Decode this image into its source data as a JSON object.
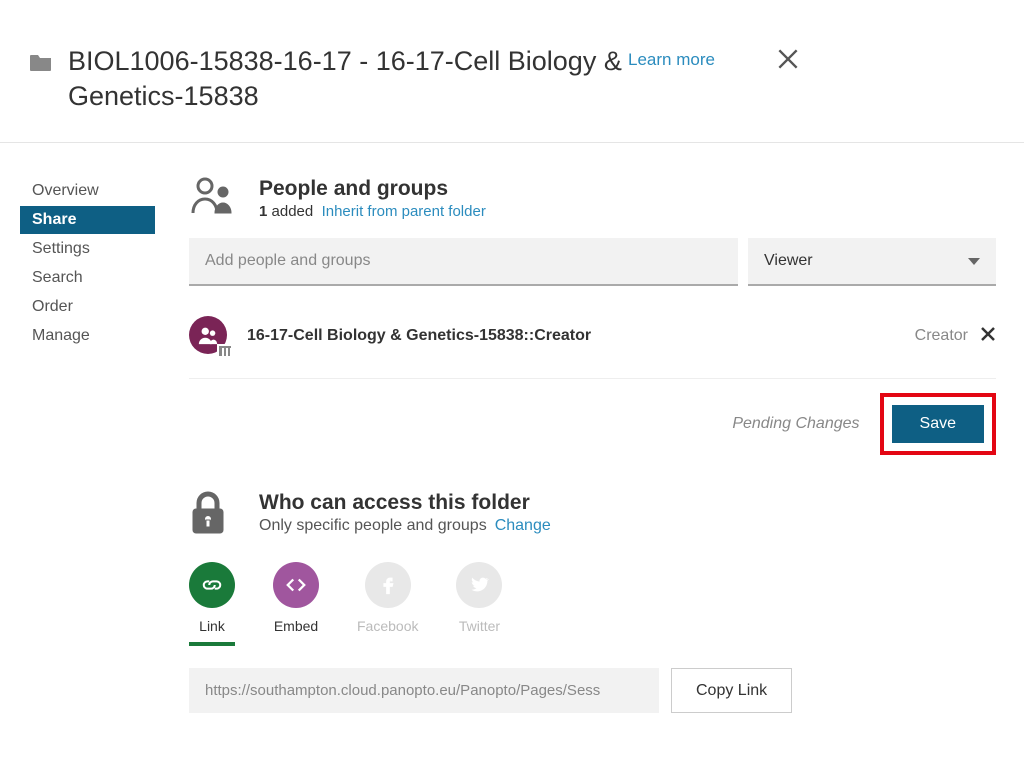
{
  "header": {
    "title": "BIOL1006-15838-16-17 - 16-17-Cell Biology & Genetics-15838",
    "learn_more": "Learn more"
  },
  "sidebar": {
    "items": [
      {
        "label": "Overview",
        "active": false
      },
      {
        "label": "Share",
        "active": true
      },
      {
        "label": "Settings",
        "active": false
      },
      {
        "label": "Search",
        "active": false
      },
      {
        "label": "Order",
        "active": false
      },
      {
        "label": "Manage",
        "active": false
      }
    ]
  },
  "people": {
    "title": "People and groups",
    "count": "1",
    "added_word": "added",
    "inherit_link": "Inherit from parent folder",
    "add_placeholder": "Add people and groups",
    "role_selected": "Viewer",
    "entries": [
      {
        "name": "16-17-Cell Biology & Genetics-15838::Creator",
        "role": "Creator"
      }
    ],
    "pending_label": "Pending Changes",
    "save_label": "Save"
  },
  "access": {
    "title": "Who can access this folder",
    "subtitle": "Only specific people and groups",
    "change_label": "Change",
    "share_options": [
      {
        "key": "link",
        "label": "Link",
        "enabled": true
      },
      {
        "key": "embed",
        "label": "Embed",
        "enabled": true
      },
      {
        "key": "facebook",
        "label": "Facebook",
        "enabled": false
      },
      {
        "key": "twitter",
        "label": "Twitter",
        "enabled": false
      }
    ],
    "url_value": "https://southampton.cloud.panopto.eu/Panopto/Pages/Sess",
    "copy_label": "Copy Link"
  }
}
